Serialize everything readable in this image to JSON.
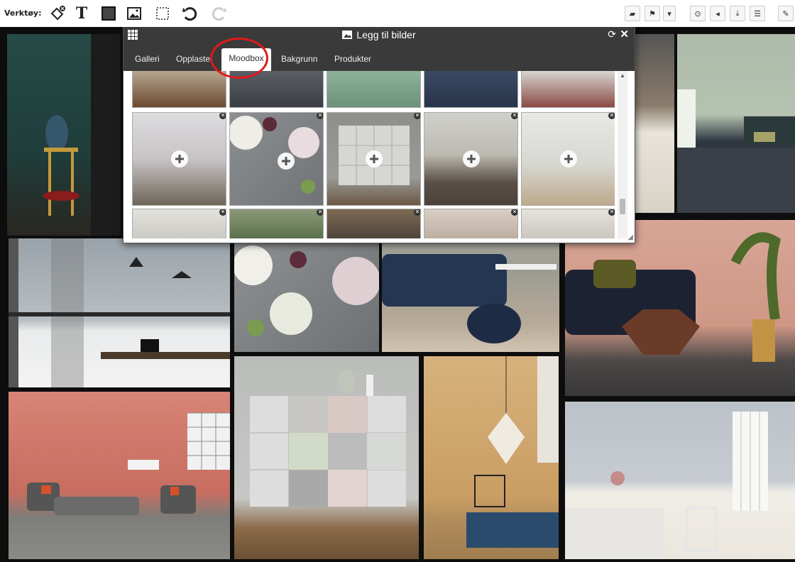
{
  "toolbar": {
    "label": "Verktøy:",
    "tools": [
      "paint-bucket-icon",
      "text-icon",
      "rectangle-icon",
      "image-icon",
      "select-icon",
      "undo-icon",
      "redo-icon"
    ],
    "right_buttons": [
      "open-folder-icon",
      "flag-icon",
      "dropdown-icon",
      "circle-icon",
      "send-icon",
      "download-icon",
      "list-icon",
      "edit-icon"
    ]
  },
  "dialog": {
    "title": "Legg til bilder",
    "tabs": [
      {
        "label": "Galleri"
      },
      {
        "label": "Opplaste"
      },
      {
        "label": "Moodbox"
      },
      {
        "label": "Bakgrunn"
      },
      {
        "label": "Produkter"
      }
    ],
    "active_tab": "Moodbox"
  },
  "colors": {
    "dialog_header": "#3a3a3a",
    "highlight_ring": "#e0191c",
    "board_bg": "#0d0d0d"
  }
}
